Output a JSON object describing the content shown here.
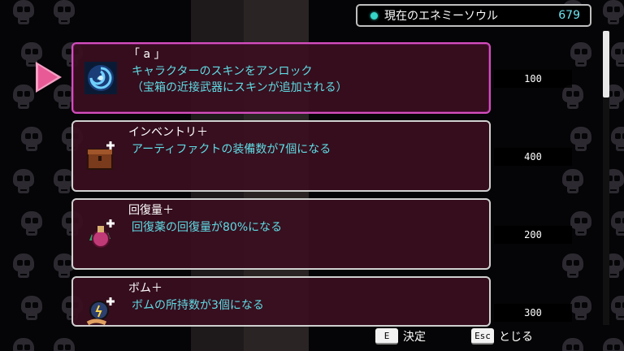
{
  "hud": {
    "soul_label": "現在のエネミーソウル",
    "soul_value": "679"
  },
  "items": [
    {
      "title": "「 a 」",
      "description": "キャラクターのスキンをアンロック\n（宝箱の近接武器にスキンが追加される）",
      "price": "100",
      "icon": "swirl-vortex-icon",
      "selected": true
    },
    {
      "title": "インベントリ＋",
      "description": "アーティファクトの装備数が7個になる",
      "price": "400",
      "icon": "chest-plus-icon",
      "selected": false
    },
    {
      "title": "回復量＋",
      "description": "回復薬の回復量が80%になる",
      "price": "200",
      "icon": "potion-plus-icon",
      "selected": false
    },
    {
      "title": "ボム＋",
      "description": "ボムの所持数が3個になる",
      "price": "300",
      "icon": "bomb-plus-icon",
      "selected": false
    }
  ],
  "controls": {
    "confirm_key": "E",
    "confirm_label": "決定",
    "close_key": "Esc",
    "close_label": "とじる"
  },
  "colors": {
    "accent_cyan": "#5fdde6",
    "selected_border": "#d44fbd",
    "cursor_pink": "#e85a96"
  }
}
